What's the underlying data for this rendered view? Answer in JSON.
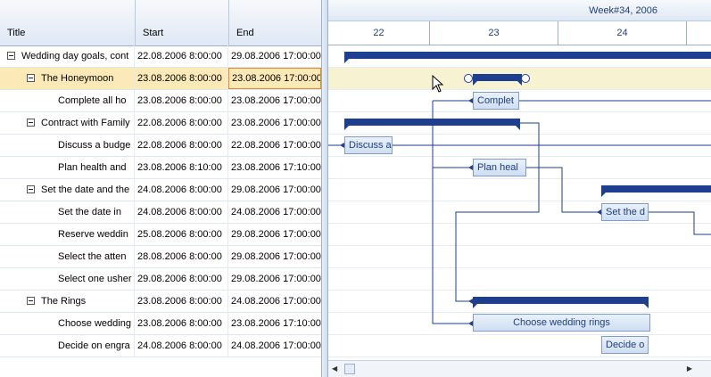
{
  "grid": {
    "headers": {
      "title": "Title",
      "start": "Start",
      "end": "End"
    },
    "rows": [
      {
        "title": "Wedding day goals, cont",
        "start": "22.08.2006 8:00:00",
        "end": "29.08.2006 17:00:00",
        "level": 0,
        "expandable": true,
        "selected": false
      },
      {
        "title": "The Honeymoon",
        "start": "23.08.2006 8:00:00",
        "end": "23.08.2006 17:00:00",
        "level": 1,
        "expandable": true,
        "selected": true
      },
      {
        "title": "Complete all ho",
        "start": "23.08.2006 8:00:00",
        "end": "23.08.2006 17:00:00",
        "level": 2,
        "expandable": false,
        "selected": false
      },
      {
        "title": "Contract with Family",
        "start": "22.08.2006 8:00:00",
        "end": "23.08.2006 17:00:00",
        "level": 1,
        "expandable": true,
        "selected": false
      },
      {
        "title": "Discuss a budge",
        "start": "22.08.2006 8:00:00",
        "end": "22.08.2006 17:00:00",
        "level": 2,
        "expandable": false,
        "selected": false
      },
      {
        "title": "Plan health and",
        "start": "23.08.2006 8:10:00",
        "end": "23.08.2006 17:10:00",
        "level": 2,
        "expandable": false,
        "selected": false
      },
      {
        "title": "Set the date and the",
        "start": "24.08.2006 8:00:00",
        "end": "29.08.2006 17:00:00",
        "level": 1,
        "expandable": true,
        "selected": false
      },
      {
        "title": "Set the date in",
        "start": "24.08.2006 8:00:00",
        "end": "24.08.2006 17:00:00",
        "level": 2,
        "expandable": false,
        "selected": false
      },
      {
        "title": "Reserve weddin",
        "start": "25.08.2006 8:00:00",
        "end": "29.08.2006 17:00:00",
        "level": 2,
        "expandable": false,
        "selected": false
      },
      {
        "title": "Select the atten",
        "start": "28.08.2006 8:00:00",
        "end": "29.08.2006 17:00:00",
        "level": 2,
        "expandable": false,
        "selected": false
      },
      {
        "title": "Select one usher",
        "start": "29.08.2006 8:00:00",
        "end": "29.08.2006 17:00:00",
        "level": 2,
        "expandable": false,
        "selected": false
      },
      {
        "title": "The Rings",
        "start": "23.08.2006 8:00:00",
        "end": "24.08.2006 17:00:00",
        "level": 1,
        "expandable": true,
        "selected": false
      },
      {
        "title": "Choose wedding",
        "start": "23.08.2006 8:00:00",
        "end": "23.08.2006 17:10:00",
        "level": 2,
        "expandable": false,
        "selected": false
      },
      {
        "title": "Decide on engra",
        "start": "24.08.2006 8:00:00",
        "end": "24.08.2006 17:00:00",
        "level": 2,
        "expandable": false,
        "selected": false
      }
    ]
  },
  "timeline": {
    "week_label": "Week#34, 2006",
    "days": [
      "22",
      "23",
      "24"
    ]
  },
  "tasks": {
    "complete": "Complet",
    "discuss": "Discuss a",
    "plan": "Plan heal",
    "setdate": "Set the d",
    "rings": "Choose wedding rings",
    "decide": "Decide o"
  },
  "colors": {
    "summary_bar": "#1e3f8f",
    "task_fill": "#d6e3f4",
    "selection": "#fbe9b7",
    "accent_border": "#e8892e"
  }
}
